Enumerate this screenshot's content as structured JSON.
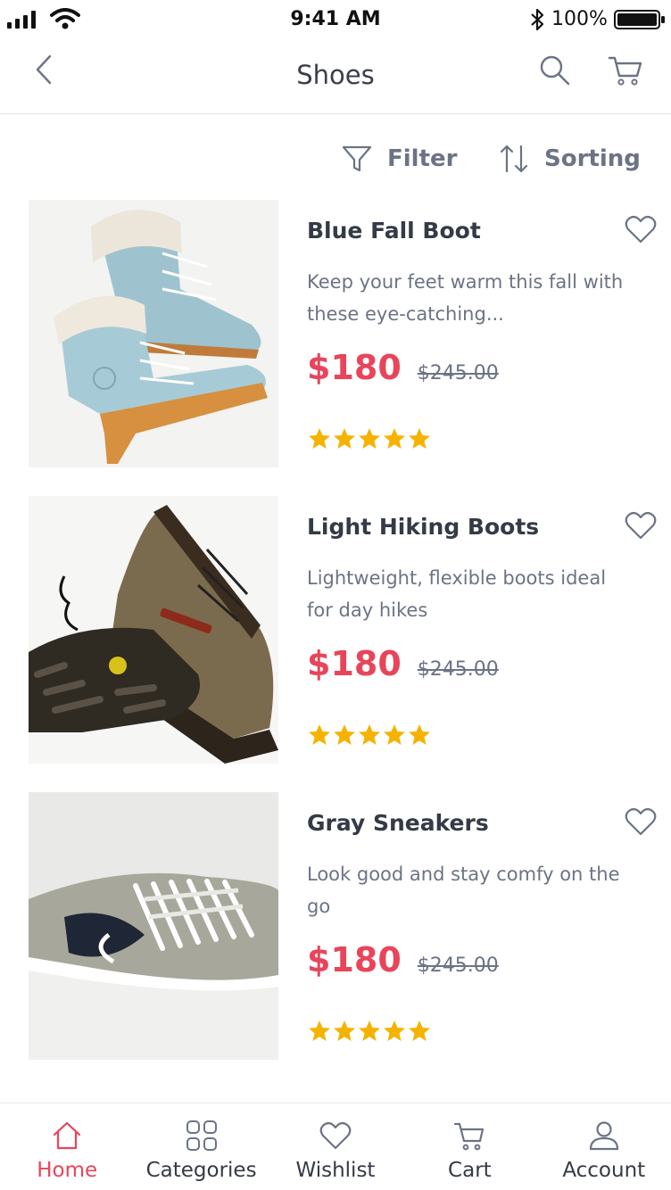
{
  "status_bar": {
    "time": "9:41 AM",
    "battery": "100%",
    "icons": [
      "signal-icon",
      "wifi-icon",
      "bluetooth-icon",
      "battery-icon"
    ]
  },
  "header": {
    "title": "Shoes",
    "icons": [
      "back-chevron-icon",
      "search-icon",
      "cart-icon"
    ]
  },
  "toolbar": {
    "filter_label": "Filter",
    "sorting_label": "Sorting",
    "icons": [
      "filter-funnel-icon",
      "sort-arrows-icon"
    ]
  },
  "colors": {
    "accent": "#e8455a",
    "text_primary": "#343a46",
    "text_secondary": "#6b7385",
    "star": "#f5b301"
  },
  "products": [
    {
      "name": "Blue Fall Boot",
      "description": "Keep your feet warm this fall with these eye-catching...",
      "price": "$180",
      "old_price": "$245.00",
      "rating": 5,
      "image": "blue-boots-photo"
    },
    {
      "name": "Light Hiking Boots",
      "description": "Lightweight, flexible boots ideal for day hikes",
      "price": "$180",
      "old_price": "$245.00",
      "rating": 5,
      "image": "hiking-boots-photo"
    },
    {
      "name": "Gray Sneakers",
      "description": "Look good and stay comfy on the go",
      "price": "$180",
      "old_price": "$245.00",
      "rating": 5,
      "image": "gray-sneaker-photo"
    }
  ],
  "tab_bar": {
    "active": "Home",
    "tabs": [
      {
        "label": "Home",
        "icon": "home-icon"
      },
      {
        "label": "Categories",
        "icon": "grid-icon"
      },
      {
        "label": "Wishlist",
        "icon": "heart-icon"
      },
      {
        "label": "Cart",
        "icon": "cart-icon"
      },
      {
        "label": "Account",
        "icon": "user-icon"
      }
    ]
  }
}
